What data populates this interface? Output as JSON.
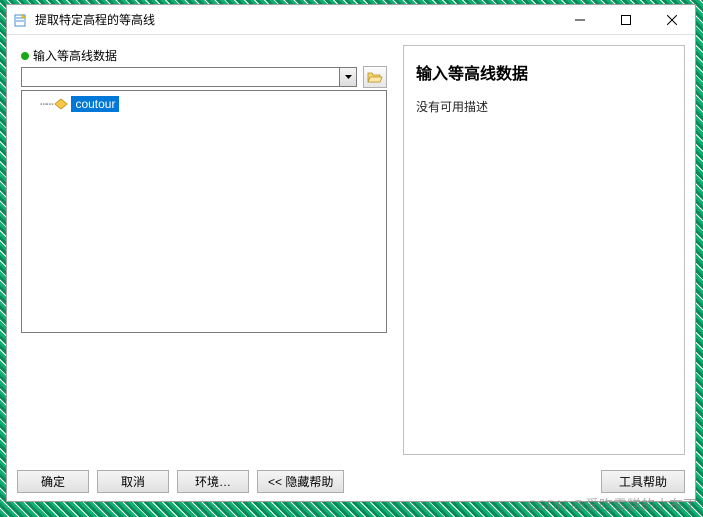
{
  "window": {
    "title": "提取特定高程的等高线"
  },
  "left": {
    "label": "输入等高线数据",
    "combo_value": "",
    "tree_item_label": "coutour"
  },
  "right": {
    "heading": "输入等高线数据",
    "description": "没有可用描述"
  },
  "buttons": {
    "ok": "确定",
    "cancel": "取消",
    "env": "环境…",
    "hide_help": "<< 隐藏帮助",
    "tool_help": "工具帮助"
  },
  "watermark": "CSDN @爱吃雪糕的小布丁"
}
